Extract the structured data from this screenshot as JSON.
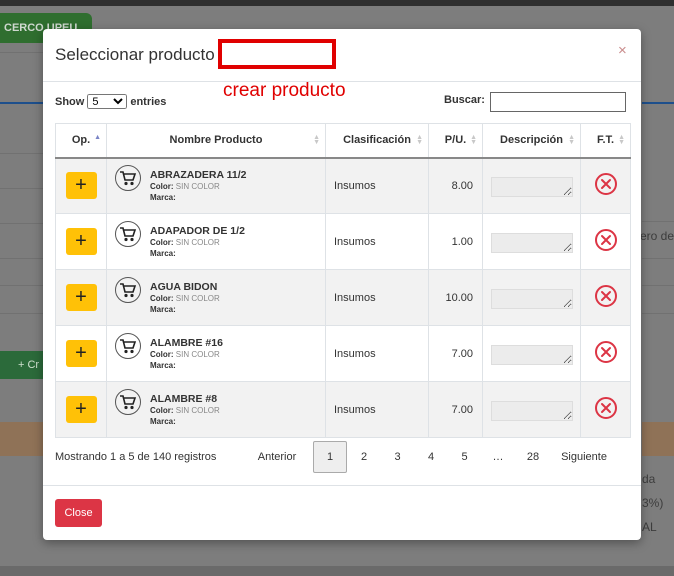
{
  "background": {
    "tab_label": "CERCO UPEU",
    "green_button": "+ Cr",
    "right_texts": [
      "rero de",
      "da",
      "3%)",
      "AL"
    ]
  },
  "modal": {
    "title": "Seleccionar producto",
    "annotation": "crear producto",
    "close_icon": "×",
    "show_label": "Show",
    "entries_label": "entries",
    "page_size": "5",
    "page_size_options": [
      "5"
    ],
    "search_label": "Buscar:",
    "search_value": "",
    "columns": [
      "Op.",
      "Nombre Producto",
      "Clasificación",
      "P/U.",
      "Descripción",
      "F.T."
    ],
    "rows": [
      {
        "name": "ABRAZADERA 11/2",
        "color_label": "Color:",
        "color": "SIN COLOR",
        "marca_label": "Marca:",
        "clasificacion": "Insumos",
        "pu": "8.00"
      },
      {
        "name": "ADAPADOR DE 1/2",
        "color_label": "Color:",
        "color": "SIN COLOR",
        "marca_label": "Marca:",
        "clasificacion": "Insumos",
        "pu": "1.00"
      },
      {
        "name": "AGUA BIDON",
        "color_label": "Color:",
        "color": "SIN COLOR",
        "marca_label": "Marca:",
        "clasificacion": "Insumos",
        "pu": "10.00"
      },
      {
        "name": "ALAMBRE #16",
        "color_label": "Color:",
        "color": "SIN COLOR",
        "marca_label": "Marca:",
        "clasificacion": "Insumos",
        "pu": "7.00"
      },
      {
        "name": "ALAMBRE #8",
        "color_label": "Color:",
        "color": "SIN COLOR",
        "marca_label": "Marca:",
        "clasificacion": "Insumos",
        "pu": "7.00"
      }
    ],
    "add_label": "+",
    "info": "Mostrando 1 a 5 de 140 registros",
    "pagination": {
      "prev": "Anterior",
      "pages": [
        "1",
        "2",
        "3",
        "4",
        "5",
        "…",
        "28"
      ],
      "next": "Siguiente",
      "active": "1"
    },
    "close_button": "Close"
  },
  "colors": {
    "add_button": "#ffc107",
    "delete_icon": "#dc3545",
    "close_button": "#dc3545",
    "annotation": "#e00000"
  },
  "icons": {
    "row_product": "cart-icon",
    "row_delete": "x-circle-icon"
  }
}
